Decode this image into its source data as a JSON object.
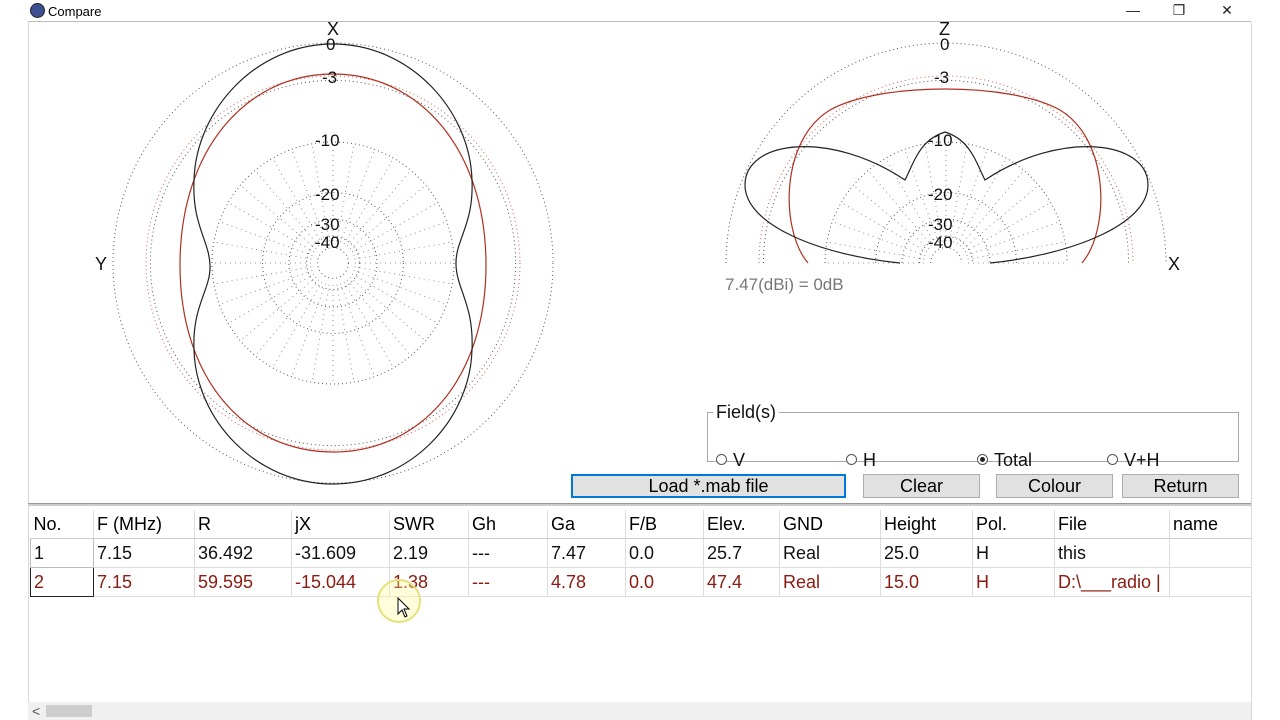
{
  "window": {
    "title": "Compare",
    "controls": {
      "minimize": "—",
      "restore": "❐",
      "close": "✕"
    }
  },
  "plots": {
    "azimuth": {
      "top_axis": "X",
      "left_axis": "Y",
      "ring_labels": [
        "0",
        "-3",
        "-10",
        "-20",
        "-30",
        "-40"
      ]
    },
    "elevation": {
      "top_axis": "Z",
      "right_axis": "X",
      "ring_labels": [
        "0",
        "-3",
        "-10",
        "-20",
        "-30",
        "-40"
      ]
    },
    "gain_reference": "7.47(dBi) = 0dB",
    "trace_colors": {
      "file1": "#222222",
      "file2": "#b03020"
    }
  },
  "fields": {
    "legend": "Field(s)",
    "options": [
      {
        "label": "V",
        "selected": false
      },
      {
        "label": "H",
        "selected": false
      },
      {
        "label": "Total",
        "selected": true
      },
      {
        "label": "V+H",
        "selected": false
      }
    ]
  },
  "buttons": {
    "load": "Load *.mab file",
    "clear": "Clear",
    "colour": "Colour",
    "return": "Return"
  },
  "table": {
    "columns": [
      "No.",
      "F (MHz)",
      "R",
      "jX",
      "SWR",
      "Gh",
      "Ga",
      "F/B",
      "Elev.",
      "GND",
      "Height",
      "Pol.",
      "File",
      "name"
    ],
    "rows": [
      {
        "color": "#111111",
        "cells": [
          "1",
          "7.15",
          "36.492",
          "-31.609",
          "2.19",
          "---",
          "7.47",
          "0.0",
          "25.7",
          "Real",
          "25.0",
          "H",
          "this",
          ""
        ]
      },
      {
        "color": "#8b1a10",
        "cells": [
          "2",
          "7.15",
          "59.595",
          "-15.044",
          "1.38",
          "---",
          "4.78",
          "0.0",
          "47.4",
          "Real",
          "15.0",
          "H",
          "D:\\___radio |",
          ""
        ]
      }
    ]
  },
  "scrollbar": {
    "left_arrow": "<"
  }
}
